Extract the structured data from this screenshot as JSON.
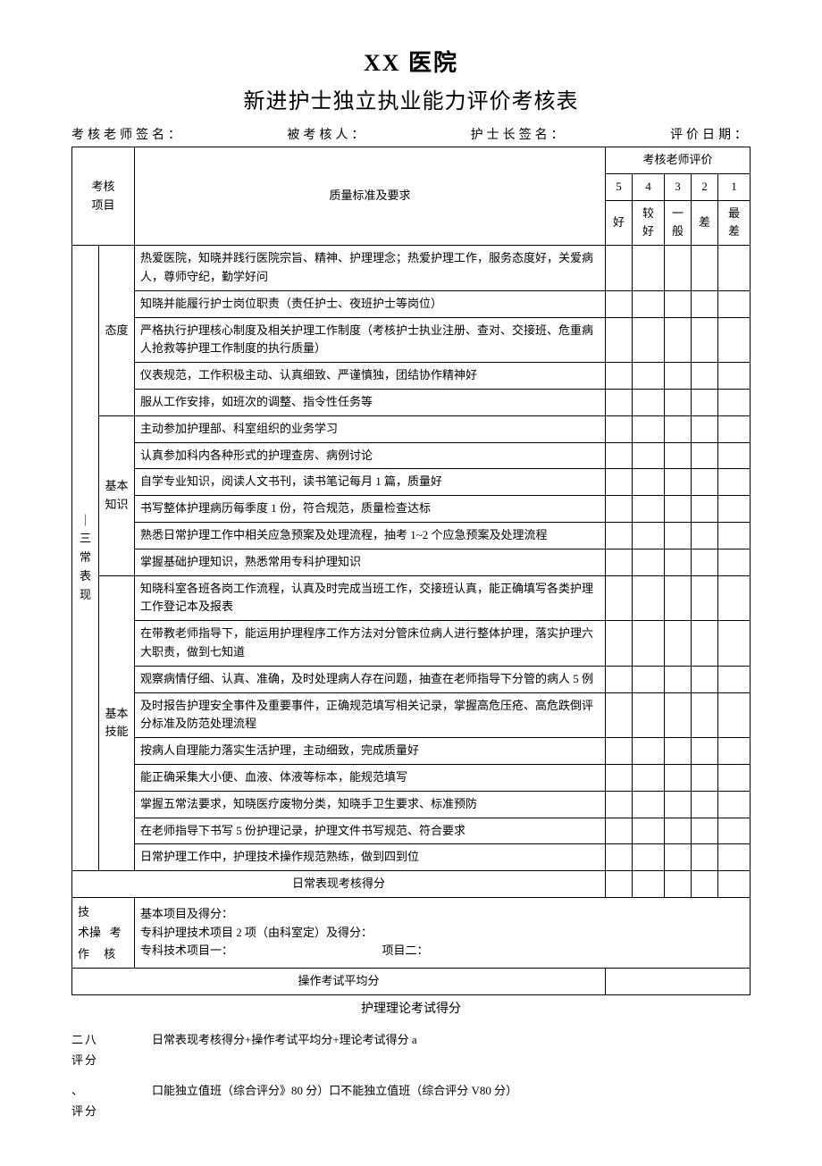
{
  "title_line1": "XX 医院",
  "title_line2": "新进护士独立执业能力评价考核表",
  "sig": {
    "examiner": "考核老师签名：",
    "examinee": "被考核人：",
    "headnurse": "护士长签名：",
    "date": "评价日期："
  },
  "headers": {
    "project": "考核\n项目",
    "standard": "质量标准及要求",
    "eval": "考核老师评价",
    "s5n": "5",
    "s4n": "4",
    "s3n": "3",
    "s2n": "2",
    "s1n": "1",
    "s5t": "好",
    "s4t": "较好",
    "s3t": "一\n般",
    "s2t": "差",
    "s1t": "最差"
  },
  "cat_daily": "｜三\n常表\n现",
  "sub_attitude": "态度",
  "sub_knowledge": "基本\n知识",
  "sub_skill": "基本\n技能",
  "rows_attitude": [
    "热爱医院，知晓并践行医院宗旨、精神、护理理念；热爱护理工作，服务态度好，关爱病人，尊师守纪，勤学好问",
    "知晓并能履行护士岗位职责（责任护士、夜班护士等岗位）",
    "严格执行护理核心制度及相关护理工作制度（考核护士执业注册、查对、交接班、危重病人抢救等护理工作制度的执行质量）",
    "仪表规范，工作积极主动、认真细致、严谨慎独，团结协作精神好",
    "服从工作安排，如班次的调整、指令性任务等"
  ],
  "rows_knowledge": [
    "主动参加护理部、科室组织的业务学习",
    "认真参加科内各种形式的护理查房、病例讨论",
    "自学专业知识，阅读人文书刊，读书笔记每月 1 篇，质量好",
    "书写整体护理病历每季度 1 份，符合规范，质量检查达标",
    "熟悉日常护理工作中相关应急预案及处理流程，抽考 1~2 个应急预案及处理流程",
    "掌握基础护理知识，熟悉常用专科护理知识"
  ],
  "rows_skill": [
    "知晓科室各班各岗工作流程，认真及时完成当班工作，交接班认真，能正确填写各类护理工作登记本及报表",
    "在带教老师指导下，能运用护理程序工作方法对分管床位病人进行整体护理，落实护理六大职责，做到七知道",
    "观察病情仔细、认真、准确，及时处理病人存在问题，抽查在老师指导下分管的病人 5 例",
    "及时报告护理安全事件及重要事件，正确规范填写相关记录，掌握高危压疮、高危跌倒评分标准及防范处理流程",
    "按病人自理能力落实生活护理，主动细致，完成质量好",
    "能正确采集大小便、血液、体液等标本，能规范填写",
    "掌握五常法要求，知晓医疗废物分类，知晓手卫生要求、标准预防",
    "在老师指导下书写 5 份护理记录，护理文件书写规范、符合要求",
    "日常护理工作中，护理技术操作规范熟练，做到四到位"
  ],
  "daily_score_label": "日常表现考核得分",
  "tech_label": "技\n术操   考\n作     核",
  "tech_lines": {
    "l1": "基本项目及得分：",
    "l2": "专科护理技术项目 2 项（由科室定）及得分：",
    "l3a": "专科技术项目一：",
    "l3b": "项目二："
  },
  "op_avg_label": "操作考试平均分",
  "theory_label": "护理理论考试得分",
  "bottom": {
    "label1": "二八\n评分",
    "text1": "日常表现考核得分+操作考试平均分+理论考试得分 a",
    "label2": "、\n评分",
    "text2": "口能独立值班（综合评分》80 分）口不能独立值班（综合评分 V80 分）"
  }
}
